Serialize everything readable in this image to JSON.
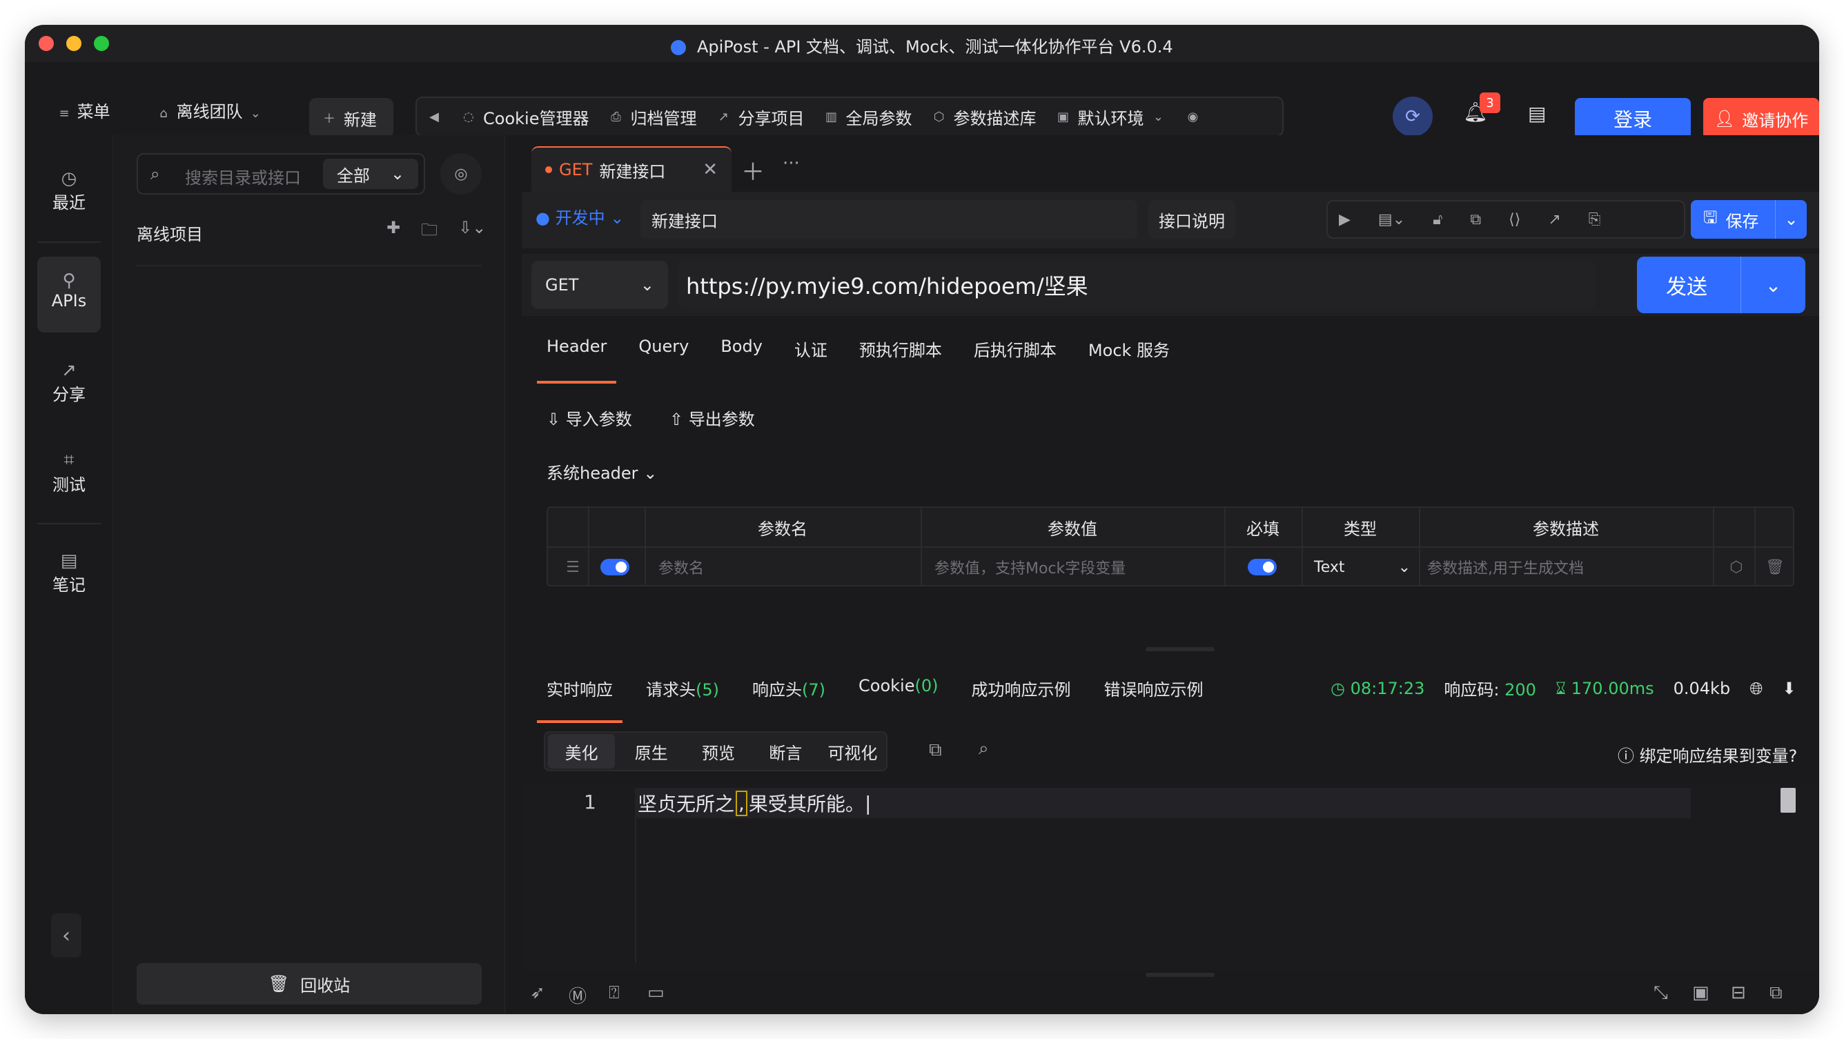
{
  "window": {
    "title": "ApiPost - API 文档、调试、Mock、测试一体化协作平台 V6.0.4"
  },
  "toolbar": {
    "menu": "菜单",
    "team": "离线团队",
    "new": "新建",
    "cookie": "Cookie管理器",
    "archive": "归档管理",
    "share": "分享项目",
    "global_params": "全局参数",
    "param_lib": "参数描述库",
    "env": "默认环境",
    "notifications": "3",
    "login": "登录",
    "invite": "邀请协作"
  },
  "rail": {
    "recent": "最近",
    "apis": "APIs",
    "share": "分享",
    "test": "测试",
    "notes": "笔记"
  },
  "sidebar": {
    "search_placeholder": "搜索目录或接口",
    "filter": "全部",
    "project_title": "离线项目",
    "recycle": "回收站"
  },
  "tabs": [
    {
      "method": "GET",
      "name": "新建接口"
    }
  ],
  "request": {
    "status": "开发中",
    "name": "新建接口",
    "doc_btn": "接口说明",
    "save": "保存",
    "method": "GET",
    "url": "https://py.myie9.com/hidepoem/坚果",
    "send": "发送"
  },
  "req_tabs": [
    "Header",
    "Query",
    "Body",
    "认证",
    "预执行脚本",
    "后执行脚本",
    "Mock 服务"
  ],
  "params": {
    "import": "导入参数",
    "export": "导出参数",
    "sys_header": "系统header",
    "headers": {
      "name": "参数名",
      "value": "参数值",
      "required": "必填",
      "type": "类型",
      "desc": "参数描述"
    },
    "row": {
      "name_ph": "参数名",
      "value_ph": "参数值，支持Mock字段变量",
      "type": "Text",
      "desc_ph": "参数描述,用于生成文档"
    }
  },
  "response": {
    "tabs": {
      "live": "实时响应",
      "req_headers": "请求头",
      "req_headers_count": "(5)",
      "resp_headers": "响应头",
      "resp_headers_count": "(7)",
      "cookie": "Cookie",
      "cookie_count": "(0)",
      "success_example": "成功响应示例",
      "error_example": "错误响应示例"
    },
    "time": "08:17:23",
    "code_label": "响应码:",
    "code": "200",
    "duration": "170.00ms",
    "size": "0.04kb",
    "views": [
      "美化",
      "原生",
      "预览",
      "断言",
      "可视化"
    ],
    "bind_var": "绑定响应结果到变量?",
    "line_no": "1",
    "body_before": "坚贞无所之",
    "body_mark": ",",
    "body_after": "果受其所能。"
  }
}
